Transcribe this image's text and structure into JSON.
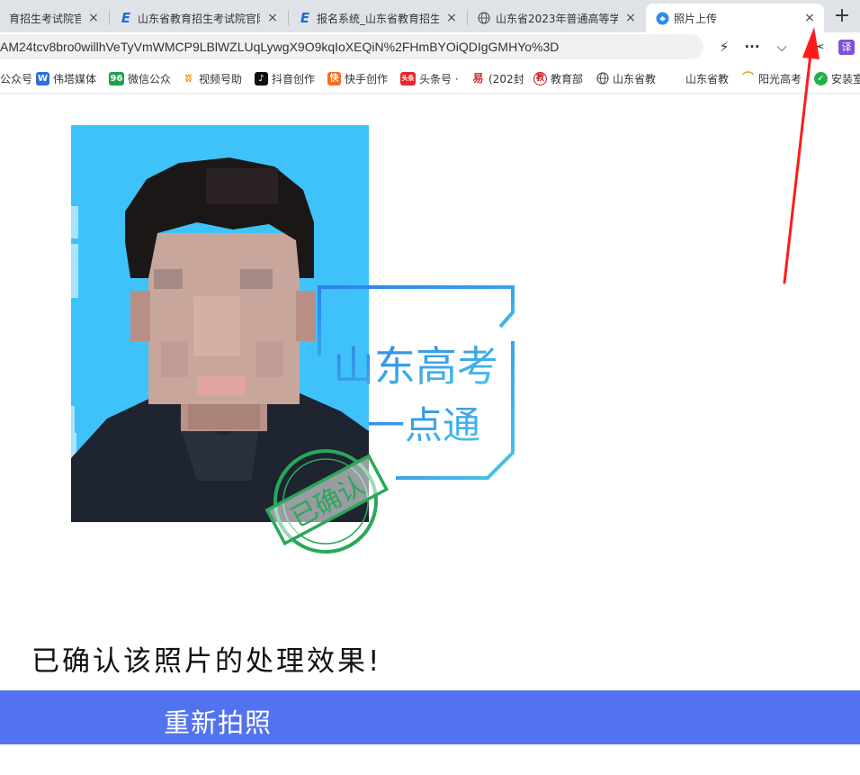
{
  "browser": {
    "tabs": [
      {
        "title": "育招生考试院官网",
        "icon": "e-logo-icon",
        "active": false
      },
      {
        "title": "山东省教育招生考试院官网",
        "icon": "e-logo-icon",
        "active": false
      },
      {
        "title": "报名系统_山东省教育招生",
        "icon": "e-logo-icon",
        "active": false
      },
      {
        "title": "山东省2023年普通高等学",
        "icon": "globe-icon",
        "active": false
      },
      {
        "title": "照片上传",
        "icon": "site-logo-icon",
        "active": true
      }
    ],
    "close_glyph": "×",
    "new_tab_glyph": "+",
    "url": "AM24tcv8bro0willhVeTyVmWMCP9LBlWZLUqLywgX9O9kqIoXEQiN%2FHmBYOiQDIgGMHYo%3D",
    "toolbar": {
      "lightning": "⚡",
      "more": "···",
      "chevron": "⌵",
      "scissors": "✂",
      "translate": "译"
    },
    "bookmarks": [
      {
        "label": "公众号",
        "icon": "none",
        "color": ""
      },
      {
        "label": "伟塔媒体",
        "icon": "W",
        "color": "#2b6fe0"
      },
      {
        "label": "微信公众",
        "icon": "96",
        "color": "#1aa34a"
      },
      {
        "label": "视频号助",
        "icon": "视",
        "color": "#f0a020"
      },
      {
        "label": "抖音创作",
        "icon": "♪",
        "color": "#111111"
      },
      {
        "label": "快手创作",
        "icon": "快",
        "color": "#ff6a1a"
      },
      {
        "label": "头条号 ·",
        "icon": "头条",
        "color": "#e8262e"
      },
      {
        "label": "(202封",
        "icon": "易",
        "color": "#d8262e"
      },
      {
        "label": "教育部",
        "icon": "教",
        "color": "#c8161e"
      },
      {
        "label": "山东省教",
        "icon": "globe",
        "color": "#666666"
      },
      {
        "label": "山东省教",
        "icon": "E",
        "color": "#1a6fd6"
      },
      {
        "label": "阳光高考",
        "icon": "☀",
        "color": "#f0a020"
      },
      {
        "label": "安装室",
        "icon": "✓",
        "color": "#22b04a"
      }
    ]
  },
  "photo": {
    "background_color": "#3fc2f9",
    "watermark_logo_text_line1": "山东高考",
    "watermark_logo_text_line2": "一点通",
    "stamp_text": "已确认"
  },
  "main": {
    "confirm_message": "已确认该照片的处理效果!",
    "retake_button": "重新拍照"
  },
  "colors": {
    "button_bg": "#5273f0",
    "annotation_arrow": "#ff1a1a",
    "stamp_green": "#2aa85a",
    "logo_blue": "#2f7fe8"
  }
}
